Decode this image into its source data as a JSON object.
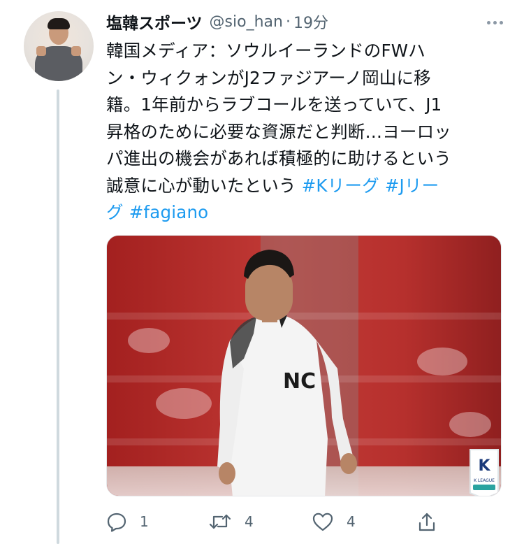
{
  "tweet": {
    "author_name": "塩韓スポーツ",
    "handle": "@sio_han",
    "separator": "·",
    "time": "19分",
    "text_lines": [
      "韓国メディア：ソウルイーランドのFWハ",
      "ン・ウィクォンがJ2ファジアーノ岡山に移",
      "籍。1年前からラブコールを送っていて、J1",
      "昇格のために必要な資源だと判断…ヨーロッ",
      "パ進出の機会があれば積極的に助けるという",
      "誠意に心が動いたという"
    ],
    "hashtags": {
      "k_league_part1": "#Kリーグ",
      "j_league_part1": "#Jリー",
      "j_league_part2": "グ",
      "fagiano": "#fagiano"
    },
    "media_logo_text": "K LEAGUE",
    "counts": {
      "replies": "1",
      "retweets": "4",
      "likes": "4"
    }
  },
  "icons": {
    "reply": "reply-icon",
    "retweet": "retweet-icon",
    "like": "like-icon",
    "share": "share-icon",
    "more": "more-icon"
  },
  "colors": {
    "text": "#0f1419",
    "secondary": "#536471",
    "link": "#1d9bf0",
    "thread_line": "#cfd9de"
  }
}
